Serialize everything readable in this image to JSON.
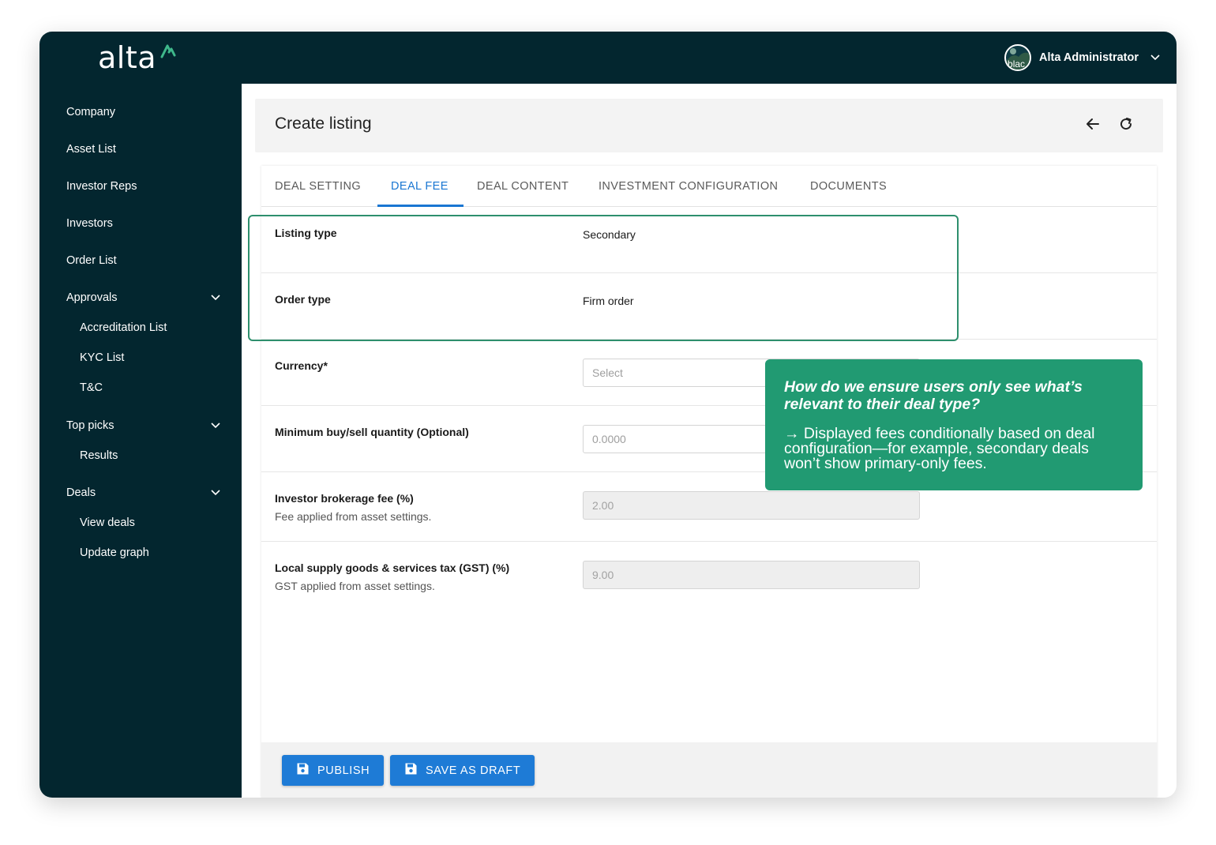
{
  "app": {
    "logo_text": "alta",
    "brand_color": "#219a72"
  },
  "user": {
    "avatar_alt": "blac",
    "name": "Alta Administrator"
  },
  "sidebar": {
    "items": [
      {
        "label": "Company"
      },
      {
        "label": "Asset List"
      },
      {
        "label": "Investor Reps"
      },
      {
        "label": "Investors"
      },
      {
        "label": "Order List"
      },
      {
        "label": "Approvals"
      },
      {
        "label": "Accreditation List"
      },
      {
        "label": "KYC List"
      },
      {
        "label": "T&C"
      },
      {
        "label": "Top picks"
      },
      {
        "label": "Results"
      },
      {
        "label": "Deals"
      },
      {
        "label": "View deals"
      },
      {
        "label": "Update graph"
      }
    ]
  },
  "header": {
    "title": "Create listing",
    "back_icon": "arrow-left-icon",
    "refresh_icon": "refresh-icon"
  },
  "tabs": [
    {
      "label": "DEAL SETTING"
    },
    {
      "label": "DEAL FEE",
      "active": true
    },
    {
      "label": "DEAL CONTENT"
    },
    {
      "label": "INVESTMENT CONFIGURATION"
    },
    {
      "label": "DOCUMENTS"
    }
  ],
  "form": {
    "listing_type": {
      "label": "Listing type",
      "value": "Secondary"
    },
    "order_type": {
      "label": "Order type",
      "value": "Firm order"
    },
    "currency": {
      "label": "Currency*",
      "placeholder": "Select"
    },
    "min_quantity": {
      "label": "Minimum buy/sell quantity (Optional)",
      "placeholder": "0.0000"
    },
    "brokerage_fee": {
      "label": "Investor brokerage fee (%)",
      "sublabel": "Fee applied from asset settings.",
      "value": "2.00"
    },
    "gst": {
      "label": "Local supply goods & services tax (GST) (%)",
      "sublabel": "GST applied from asset settings.",
      "value": "9.00"
    }
  },
  "footer": {
    "publish_label": "PUBLISH",
    "save_draft_label": "SAVE AS DRAFT"
  },
  "callout": {
    "question": "How do we ensure users only see what’s relevant to their deal type?",
    "answer": "→ Displayed fees conditionally based on deal configuration—for example, secondary deals won’t show primary-only fees."
  }
}
